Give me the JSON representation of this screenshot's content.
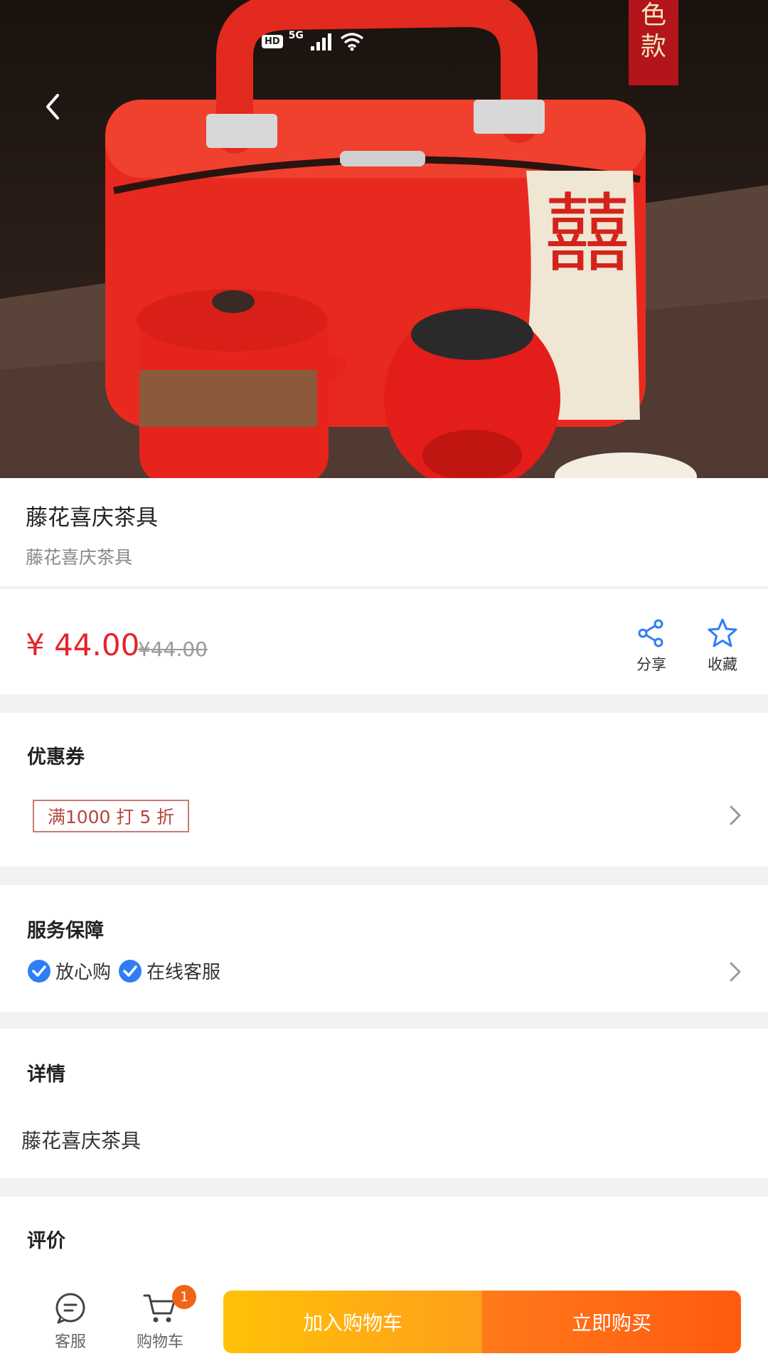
{
  "status_bar": {
    "hd": "HD",
    "network": "5G"
  },
  "product": {
    "title": "藤花喜庆茶具",
    "subtitle": "藤花喜庆茶具",
    "price_current": "¥ 44.00",
    "price_original": "¥44.00"
  },
  "actions": {
    "share_label": "分享",
    "favorite_label": "收藏"
  },
  "coupon": {
    "heading": "优惠券",
    "tag": "满1000 打 5 折"
  },
  "service": {
    "heading": "服务保障",
    "items": [
      "放心购",
      "在线客服"
    ]
  },
  "detail": {
    "heading": "详情",
    "text": "藤花喜庆茶具"
  },
  "review": {
    "heading": "评价"
  },
  "bottom_bar": {
    "customer_service_label": "客服",
    "cart_label": "购物车",
    "cart_count": "1",
    "add_to_cart_label": "加入购物车",
    "buy_now_label": "立即购买"
  },
  "hero": {
    "box_text": "囍",
    "corner_text": "色款"
  },
  "colors": {
    "price_red": "#e4242b",
    "add_cart_orange": "#ffb20f",
    "buy_now_orange": "#ff6414",
    "check_blue": "#2f7df6",
    "badge_orange": "#f06418"
  }
}
